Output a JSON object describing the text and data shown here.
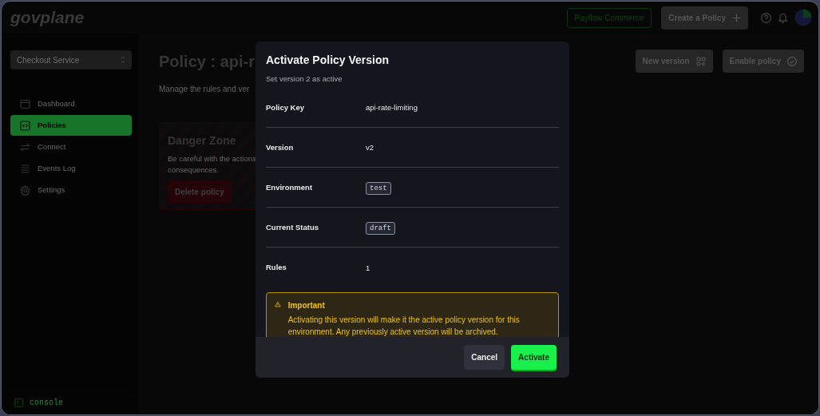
{
  "brand": "govplane",
  "topbar": {
    "org_badge": "Payflow Commerce",
    "create_button": "Create a Policy"
  },
  "sidebar": {
    "service_select": "Checkout Service",
    "items": [
      {
        "label": "Dashboard",
        "selected": false
      },
      {
        "label": "Policies",
        "selected": true
      },
      {
        "label": "Connect",
        "selected": false
      },
      {
        "label": "Events Log",
        "selected": false
      },
      {
        "label": "Settings",
        "selected": false
      }
    ],
    "footer": "console"
  },
  "page": {
    "title": "Policy : api-r",
    "subtitle": "Manage the rules and ver",
    "actions": [
      "New version",
      "Enable policy"
    ],
    "danger": {
      "title": "Danger Zone",
      "text_lines": [
        "Be careful with the actions",
        "consequences."
      ],
      "button": "Delete policy"
    }
  },
  "modal": {
    "title": "Activate Policy Version",
    "subtitle": "Set version 2 as active",
    "rows": [
      {
        "label": "Policy Key",
        "value": "api-rate-limiting",
        "kind": "text"
      },
      {
        "label": "Version",
        "value": "v2",
        "kind": "text"
      },
      {
        "label": "Environment",
        "value": "test",
        "kind": "tag"
      },
      {
        "label": "Current Status",
        "value": "draft",
        "kind": "tag"
      },
      {
        "label": "Rules",
        "value": "1",
        "kind": "text"
      }
    ],
    "notice": {
      "title": "Important",
      "text": "Activating this version will make it the active policy version for this environment. Any previously active version will be archived."
    },
    "buttons": [
      {
        "label": "Cancel",
        "kind": "secondary"
      },
      {
        "label": "Activate",
        "kind": "primary"
      }
    ]
  }
}
